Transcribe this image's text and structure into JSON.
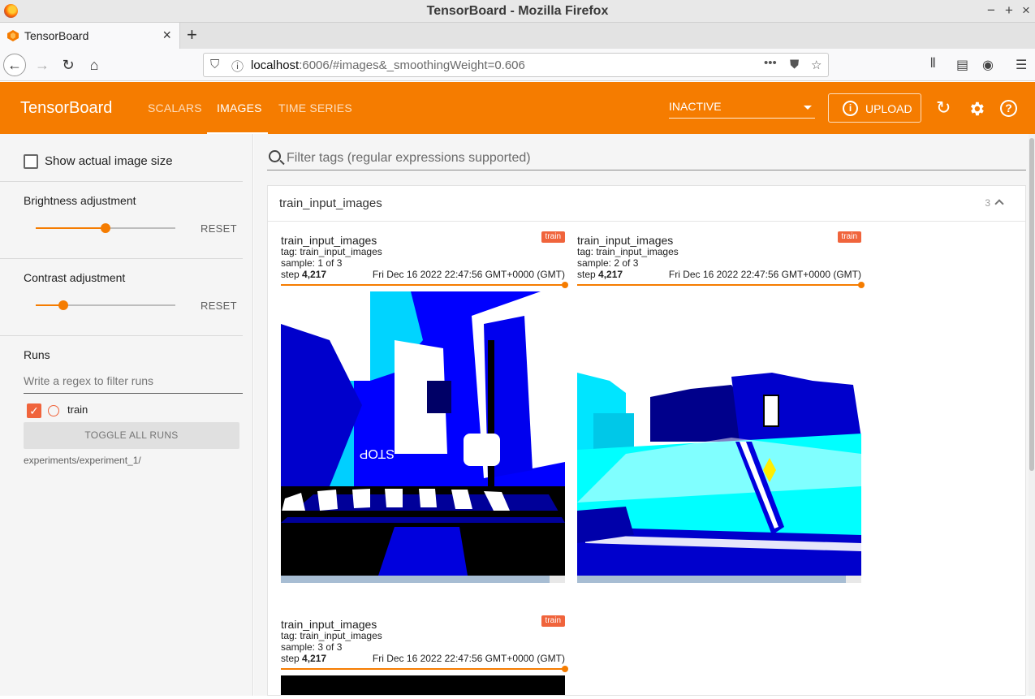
{
  "browser": {
    "window_title": "TensorBoard - Mozilla Firefox",
    "tab_title": "TensorBoard",
    "url_host": "localhost",
    "url_rest": ":6006/#images&_smoothingWeight=0.606"
  },
  "header": {
    "brand": "TensorBoard",
    "tabs": [
      {
        "label": "SCALARS",
        "active": false
      },
      {
        "label": "IMAGES",
        "active": true
      },
      {
        "label": "TIME SERIES",
        "active": false
      }
    ],
    "run_state": "INACTIVE",
    "upload_label": "UPLOAD",
    "accent": "#f57c00"
  },
  "sidebar": {
    "show_actual_size": "Show actual image size",
    "brightness_label": "Brightness adjustment",
    "brightness_value": 0.5,
    "contrast_label": "Contrast adjustment",
    "contrast_value": 0.2,
    "reset_label": "RESET",
    "runs_label": "Runs",
    "runs_filter_placeholder": "Write a regex to filter runs",
    "run_name": "train",
    "toggle_all": "TOGGLE ALL RUNS",
    "run_path": "experiments/experiment_1/"
  },
  "main": {
    "filter_placeholder": "Filter tags (regular expressions supported)",
    "card_title": "train_input_images",
    "card_count": "3",
    "panes": [
      {
        "title": "train_input_images",
        "tag": "tag: train_input_images",
        "sample": "sample: 1 of 3",
        "step_label": "step",
        "step": "4,217",
        "timestamp": "Fri Dec 16 2022 22:47:56 GMT+0000 (GMT)",
        "run": "train"
      },
      {
        "title": "train_input_images",
        "tag": "tag: train_input_images",
        "sample": "sample: 2 of 3",
        "step_label": "step",
        "step": "4,217",
        "timestamp": "Fri Dec 16 2022 22:47:56 GMT+0000 (GMT)",
        "run": "train"
      },
      {
        "title": "train_input_images",
        "tag": "tag: train_input_images",
        "sample": "sample: 3 of 3",
        "step_label": "step",
        "step": "4,217",
        "timestamp": "Fri Dec 16 2022 22:47:56 GMT+0000 (GMT)",
        "run": "train"
      }
    ]
  }
}
